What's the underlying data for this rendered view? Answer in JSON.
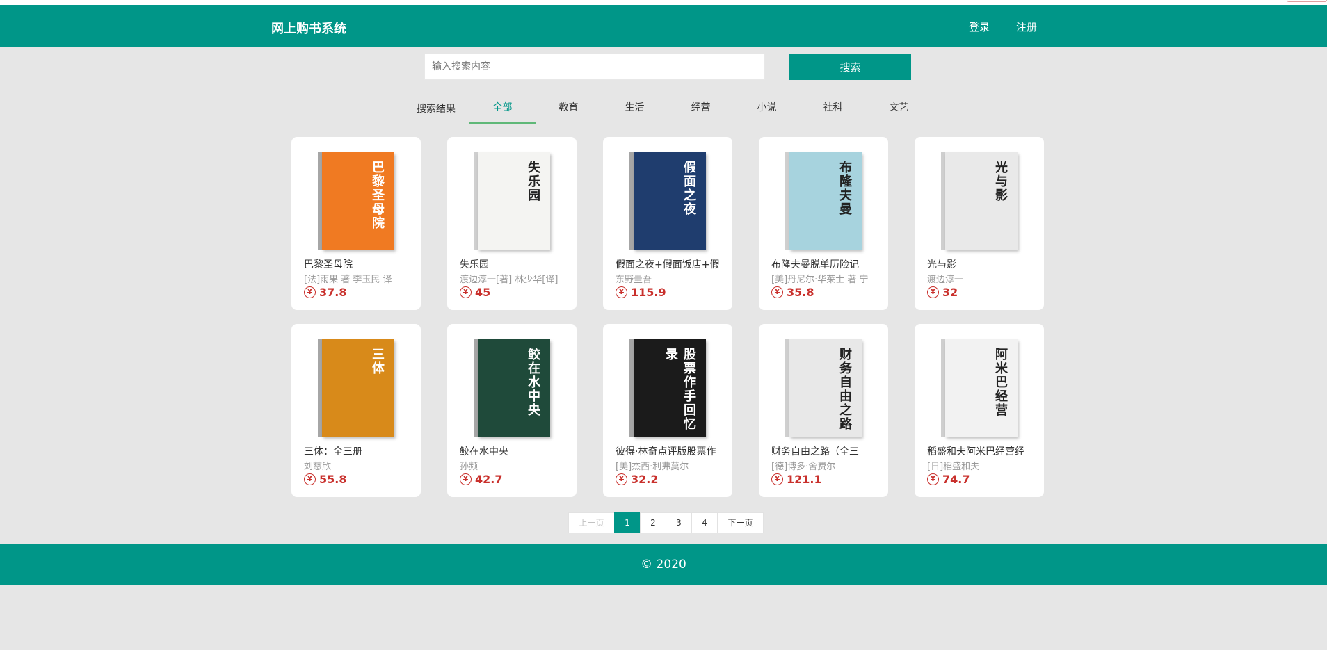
{
  "header": {
    "brand": "网上购书系统",
    "login": "登录",
    "register": "注册"
  },
  "search": {
    "placeholder": "输入搜索内容",
    "button": "搜索"
  },
  "tabs": {
    "label": "搜索结果",
    "items": [
      "全部",
      "教育",
      "生活",
      "经营",
      "小说",
      "社科",
      "文艺"
    ],
    "active": "全部"
  },
  "books": [
    {
      "name": "巴黎圣母院",
      "author": "[法]雨果 著 李玉民 译",
      "price": "37.8",
      "cover_color": "#f07a22",
      "cover_title": "巴黎圣母院"
    },
    {
      "name": "失乐园",
      "author": "渡边淳一[著] 林少华[译]",
      "price": "45",
      "cover_color": "#f4f4f2",
      "cover_title": "失乐园"
    },
    {
      "name": "假面之夜+假面饭店+假",
      "author": "东野圭吾",
      "price": "115.9",
      "cover_color": "#1f3d6e",
      "cover_title": "假面之夜"
    },
    {
      "name": "布隆夫曼脱单历险记",
      "author": "[美]丹尼尔·华莱士 著 宁",
      "price": "35.8",
      "cover_color": "#a7d3de",
      "cover_title": "布隆夫曼"
    },
    {
      "name": "光与影",
      "author": "渡边淳一",
      "price": "32",
      "cover_color": "#e9e9e9",
      "cover_title": "光与影"
    },
    {
      "name": "三体：全三册",
      "author": "刘慈欣",
      "price": "55.8",
      "cover_color": "#d88a1a",
      "cover_title": "三体"
    },
    {
      "name": "鲛在水中央",
      "author": "孙频",
      "price": "42.7",
      "cover_color": "#1f4a3a",
      "cover_title": "鲛在水中央"
    },
    {
      "name": "彼得·林奇点评版股票作",
      "author": "[美]杰西·利弗莫尔",
      "price": "32.2",
      "cover_color": "#1b1b1b",
      "cover_title": "股票作手回忆录"
    },
    {
      "name": "财务自由之路（全三",
      "author": "[德]博多·舍费尔",
      "price": "121.1",
      "cover_color": "#e8e8e8",
      "cover_title": "财务自由之路"
    },
    {
      "name": "稻盛和夫阿米巴经营经",
      "author": "[日]稻盛和夫",
      "price": "74.7",
      "cover_color": "#f2f2f2",
      "cover_title": "阿米巴经营"
    }
  ],
  "pager": {
    "prev": "上一页",
    "pages": [
      "1",
      "2",
      "3",
      "4"
    ],
    "current": "1",
    "next": "下一页"
  },
  "footer": {
    "text": "© 2020"
  },
  "colors": {
    "primary": "#009688",
    "price": "#c9302c",
    "background": "#e6e6e6"
  }
}
